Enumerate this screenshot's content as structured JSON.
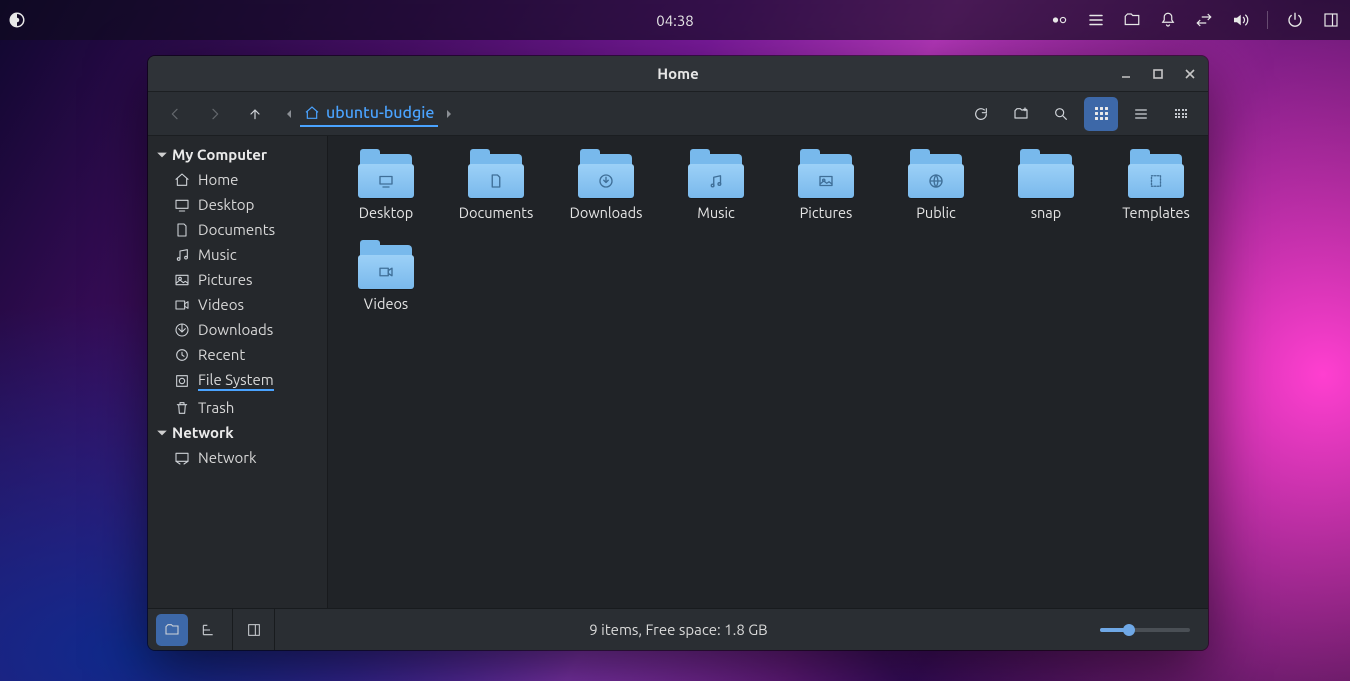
{
  "panel": {
    "clock": "04:38"
  },
  "window": {
    "title": "Home",
    "breadcrumb": {
      "home": "ubuntu-budgie"
    }
  },
  "sidebar": {
    "section1": "My Computer",
    "section2": "Network",
    "items": [
      "Home",
      "Desktop",
      "Documents",
      "Music",
      "Pictures",
      "Videos",
      "Downloads",
      "Recent",
      "File System",
      "Trash"
    ],
    "network_item": "Network"
  },
  "folders": [
    "Desktop",
    "Documents",
    "Downloads",
    "Music",
    "Pictures",
    "Public",
    "snap",
    "Templates",
    "Videos"
  ],
  "status": {
    "text": "9 items, Free space: 1.8 GB"
  }
}
